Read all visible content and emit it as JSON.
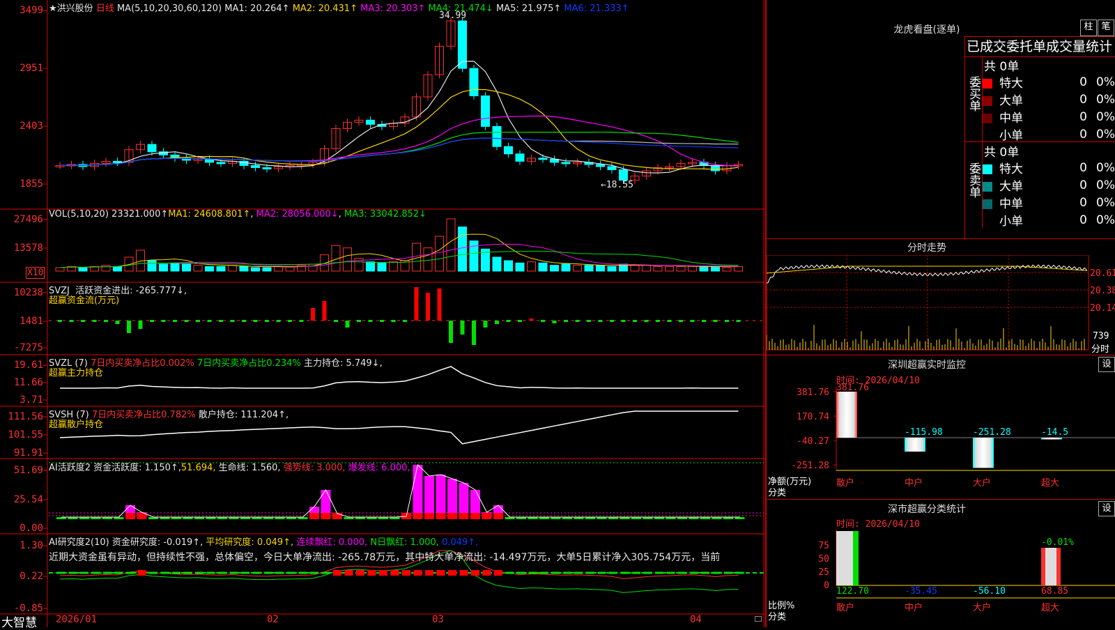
{
  "main": {
    "star": "★",
    "stock_name": "洪兴股份",
    "period": "日线",
    "ma_header": {
      "label": "MA(5,10,20,30,60,120)",
      "ma1": "MA1: 20.264↑",
      "ma2": "MA2: 20.431↑",
      "ma3": "MA3: 20.303↑",
      "ma4": "MA4: 21.474↓",
      "ma5": "MA5: 21.975↑",
      "ma6": "MA6: 21.333↑"
    },
    "price_axis": [
      "3499",
      "2951",
      "2403",
      "1855"
    ],
    "high_label": "34.99",
    "low_label": "←18.55",
    "colors": {
      "up": "#ff3030",
      "down": "#00ffff",
      "ma1": "#e8e8e8",
      "ma2": "#ffd700",
      "ma3": "#ff00ff",
      "ma4": "#00e000",
      "ma5": "#c0c0c0",
      "ma6": "#0a3cff"
    }
  },
  "vol": {
    "header": {
      "label": "VOL(5,10,20)",
      "value": "23321.000↑",
      "ma1": "MA1: 24608.801↑",
      "ma2": "MA2: 28056.000↓",
      "ma3": "MA3: 33042.852↓"
    },
    "axis": [
      "27496",
      "13578",
      "X10"
    ]
  },
  "svzj": {
    "header": {
      "label": "SVZJ",
      "text": "活跃资金进出: -265.777↓,"
    },
    "sub": "超赢资金流(万元)",
    "axis": [
      "10238",
      "1481",
      "-7275"
    ]
  },
  "svzl": {
    "header": {
      "label": "SVZL (7)",
      "red": "7日内买卖净占比0.002%",
      "green": "7日内买卖净占比0.234%",
      "white": "主力持仓: 5.749↓,"
    },
    "sub": "超赢主力持仓",
    "axis": [
      "19.61",
      "11.66",
      "3.71"
    ]
  },
  "svsh": {
    "header": {
      "label": "SVSH (7)",
      "red": "7日内买卖净占比0.782%",
      "white": "散户持仓: 111.204↑,"
    },
    "sub": "超赢散户持仓",
    "axis": [
      "111.56",
      "101.55",
      "91.91"
    ]
  },
  "ai_active": {
    "header": {
      "label": "AI活跃度2",
      "white": "资金活跃度: 1.150↑,",
      "yellow": "51.694,",
      "life": "生命线: 1.560,",
      "strong": "强势线: 3.000,",
      "burst": "爆发线: 6.000,"
    },
    "axis": [
      "51.69",
      "25.54",
      "0.00"
    ]
  },
  "ai_research": {
    "header": {
      "label": "AI研究度2(10)",
      "white": "资金研究度: -0.019↑,",
      "yellow": "平均研究度: 0.049↑,",
      "mag": "连续飘红: 0.000,",
      "green": "N日飘红: 1.000,",
      "blue": "0.049↑,"
    },
    "text": "近期大资金虽有异动，但持续性不强，总体偏空，今日大单净流出: -265.78万元，其中特大单净流出: -14.497万元，大单5日累计净入305.754万元，当前",
    "axis": [
      "1.30",
      "0.22",
      "-0.85"
    ]
  },
  "xaxis": [
    "2026/01",
    "02",
    "03",
    "04"
  ],
  "brand": "大智慧",
  "right": {
    "dragon_title": "龙虎看盘(逐单)",
    "btn_col": "柱",
    "btn_stroke": "笔",
    "stats_title": "已成交委托单成交量统计",
    "buy": {
      "side": "委买单",
      "total": "共 0单",
      "rows": [
        {
          "name": "特大",
          "count": "0",
          "pct": "0%",
          "color": "#ff0000"
        },
        {
          "name": "大单",
          "count": "0",
          "pct": "0%",
          "color": "#8b0000"
        },
        {
          "name": "中单",
          "count": "0",
          "pct": "0%",
          "color": "#6a0000"
        },
        {
          "name": "小单",
          "count": "0",
          "pct": "0%",
          "color": "#000000"
        }
      ]
    },
    "sell": {
      "side": "委卖单",
      "total": "共 0单",
      "rows": [
        {
          "name": "特大",
          "count": "0",
          "pct": "0%",
          "color": "#00ffff"
        },
        {
          "name": "大单",
          "count": "0",
          "pct": "0%",
          "color": "#008b8b"
        },
        {
          "name": "中单",
          "count": "0",
          "pct": "0%",
          "color": "#006a6a"
        },
        {
          "name": "小单",
          "count": "0",
          "pct": "0%",
          "color": "#000000"
        }
      ]
    },
    "intraday_title": "分时走势",
    "intraday_axis": [
      "20.61",
      "20.38",
      "20.14",
      "739"
    ],
    "intraday_fen": "分时",
    "monitor_title": "深圳超赢实时监控",
    "settings": "设",
    "time_label": "时间: 2026/04/10",
    "monitor_axis": [
      "381.76",
      "170.74",
      "-40.27",
      "-251.28"
    ],
    "monitor_values": [
      "381.76",
      "-115.98",
      "-251.28",
      "-14.5"
    ],
    "net_label": "净额(万元)",
    "class_label": "分类",
    "categories": [
      "散户",
      "中户",
      "大户",
      "超大"
    ],
    "classify_title": "深市超赢分类统计",
    "ratio_label": "比例%",
    "classify_axis": [
      "75",
      "50",
      "25",
      "0"
    ],
    "classify_top": "-0.01%",
    "classify_values": [
      "122.70",
      "-35.45",
      "-56.10",
      "68.85"
    ]
  }
}
